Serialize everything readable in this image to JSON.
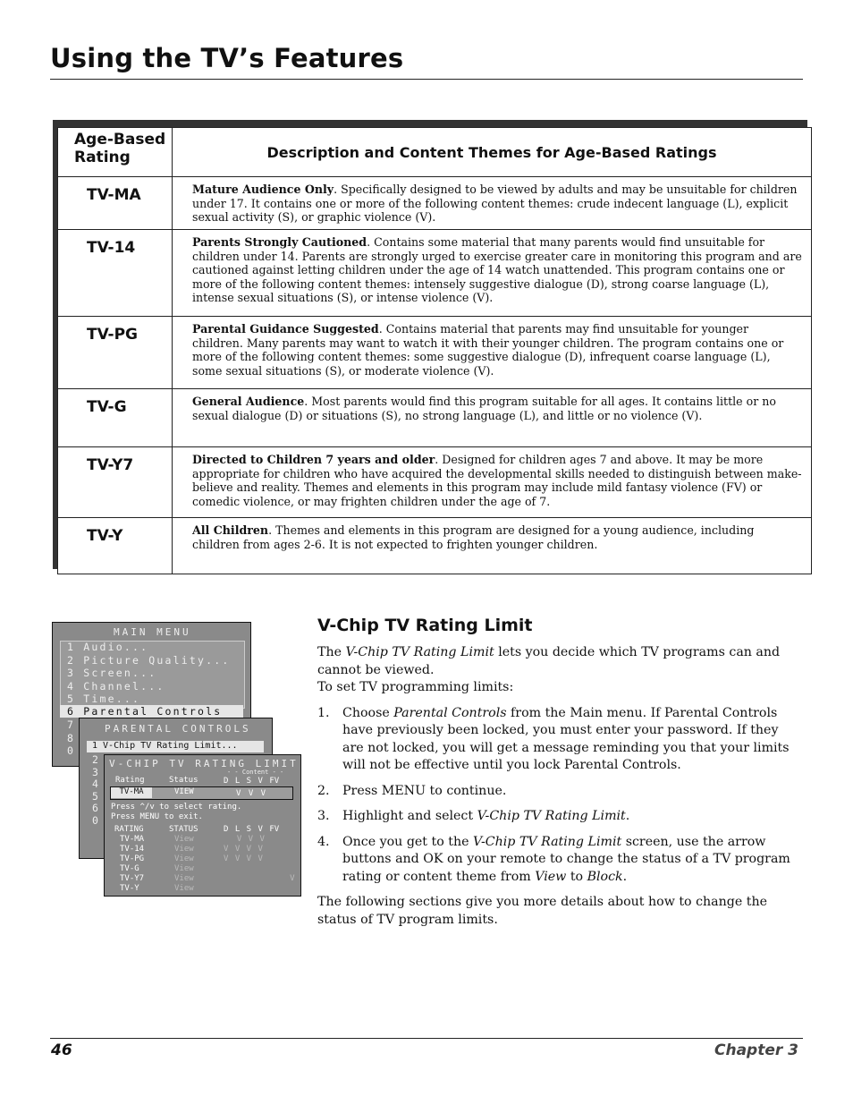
{
  "header": {
    "title": "Using the TV’s Features"
  },
  "table": {
    "col1": "Age-Based Rating",
    "col1_line1": "Age-Based",
    "col1_line2": "Rating",
    "col2": "Description and Content Themes for Age-Based Ratings",
    "rows": [
      {
        "rating": "TV-MA",
        "lead": "Mature Audience Only",
        "text": ". Specifically designed to be viewed by adults and may be unsuitable for children under 17.  It contains one or more of the following content themes:  crude indecent language (L), explicit sexual activity (S), or graphic violence (V)."
      },
      {
        "rating": "TV-14",
        "lead": "Parents Strongly Cautioned",
        "text": ". Contains some material that many parents would find unsuitable for children under 14.  Parents are strongly urged to exercise greater care in monitoring this program and are cautioned against letting children under the age of 14 watch unattended.  This program contains one or more of the following content themes:  intensely suggestive dialogue (D), strong coarse language (L), intense sexual situations (S), or intense violence (V)."
      },
      {
        "rating": "TV-PG",
        "lead": "Parental Guidance Suggested",
        "text": ". Contains material that parents may find unsuitable for younger children.  Many parents may want to watch it with their younger children.  The program contains one or more of the following content themes:  some suggestive dialogue (D), infrequent coarse language (L), some sexual situations (S), or moderate violence (V)."
      },
      {
        "rating": "TV-G",
        "lead": "General Audience",
        "text": ". Most parents would find this program suitable for all ages.  It contains little or no sexual dialogue (D) or situations (S), no strong language (L), and little or no violence (V)."
      },
      {
        "rating": "TV-Y7",
        "lead": "Directed to Children 7 years and older",
        "text": ". Designed for children ages 7 and above.  It may be more appropriate for children who have acquired the developmental skills needed to distinguish between make-believe and reality.  Themes and elements in this program may include mild fantasy violence (FV) or comedic violence, or may frighten children under the age of 7."
      },
      {
        "rating": "TV-Y",
        "lead": "All Children",
        "text": ". Themes and elements in this program are designed for a young audience, including children from ages 2-6.  It is not expected to frighten younger children."
      }
    ]
  },
  "osd": {
    "main": {
      "title": "MAIN MENU",
      "items": [
        "1 Audio...",
        "2 Picture Quality...",
        "3 Screen...",
        "4 Channel...",
        "5 Time...",
        "6 Parental Controls"
      ],
      "hidden_nums": "7\n8\n0"
    },
    "parental": {
      "title": "PARENTAL CONTROLS",
      "item": "1 V-Chip TV Rating Limit...",
      "hidden_nums": "2\n3\n4\n5\n6\n0"
    },
    "vchip": {
      "title": "V-CHIP TV RATING LIMIT",
      "content_label": "- - Content - -",
      "rating_h": "Rating",
      "status_h": "Status",
      "cols": "D L S V FV",
      "sel_rating": "TV-MA",
      "sel_status": "VIEW",
      "sel_flags": "V V V",
      "caret": "^",
      "help1": "Press ^/v to select rating.",
      "help2": "Press MENU to exit.",
      "list_rating_h": "RATING",
      "list_status_h": "STATUS",
      "list_cols": "D L S V FV",
      "list": [
        {
          "r": "TV-MA",
          "s": "View",
          "f": "  V V V"
        },
        {
          "r": "TV-14",
          "s": "View",
          "f": "V V V V"
        },
        {
          "r": "TV-PG",
          "s": "View",
          "f": "V V V V"
        },
        {
          "r": "TV-G",
          "s": "View",
          "f": ""
        },
        {
          "r": "TV-Y7",
          "s": "View",
          "f": "          V"
        },
        {
          "r": "TV-Y",
          "s": "View",
          "f": ""
        }
      ]
    }
  },
  "section": {
    "title": "V-Chip TV Rating Limit",
    "intro_pre": "The ",
    "intro_em": "V-Chip TV Rating Limit",
    "intro_post": " lets you decide which TV programs can and cannot be viewed.",
    "intro2": "To set TV programming limits:",
    "steps": [
      {
        "n": "1.",
        "pre": "Choose ",
        "em": "Parental Controls",
        "post": " from the Main menu. If Parental Controls have previously been locked, you must enter your password. If they are not locked, you will get a message reminding you that your limits will not be effective until you lock Parental Controls."
      },
      {
        "n": "2.",
        "pre": "Press MENU to continue.",
        "em": "",
        "post": ""
      },
      {
        "n": "3.",
        "pre": "Highlight and select ",
        "em": "V-Chip TV Rating Limit",
        "post": "."
      },
      {
        "n": "4.",
        "pre": "Once you get to the ",
        "em": "V-Chip TV Rating Limit",
        "post": " screen, use the arrow buttons and OK on your remote to change the status of a TV program rating or content theme from ",
        "em2": "View",
        "mid": " to ",
        "em3": "Block",
        "end": "."
      }
    ],
    "closing": "The following sections give you more details about how to change the status of TV program limits."
  },
  "footer": {
    "page": "46",
    "chapter": "Chapter 3"
  }
}
